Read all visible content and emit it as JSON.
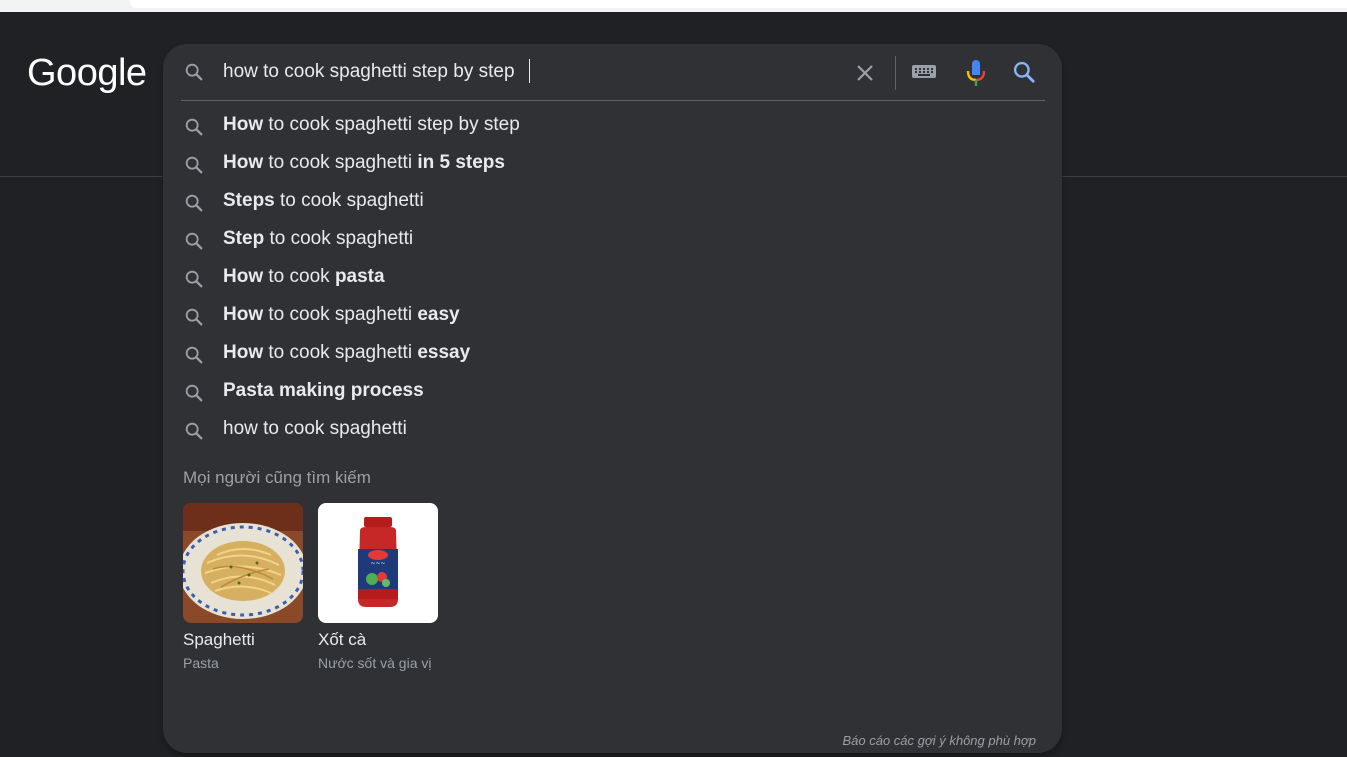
{
  "logo": {
    "text": "Google"
  },
  "search": {
    "query": "how to cook spaghetti step by step",
    "icons": {
      "lead": "search-icon",
      "clear": "close-icon",
      "keyboard": "keyboard-icon",
      "voice": "microphone-icon",
      "submit": "search-icon"
    }
  },
  "suggestions": [
    {
      "parts": [
        {
          "t": "How",
          "b": true
        },
        {
          "t": " to cook spaghetti step by step",
          "b": false
        }
      ]
    },
    {
      "parts": [
        {
          "t": "How",
          "b": true
        },
        {
          "t": " to cook spaghetti ",
          "b": false
        },
        {
          "t": "in 5 steps",
          "b": true
        }
      ]
    },
    {
      "parts": [
        {
          "t": "Steps",
          "b": true
        },
        {
          "t": " to cook spaghetti",
          "b": false
        }
      ]
    },
    {
      "parts": [
        {
          "t": "Step",
          "b": true
        },
        {
          "t": " to cook spaghetti",
          "b": false
        }
      ]
    },
    {
      "parts": [
        {
          "t": "How",
          "b": true
        },
        {
          "t": " to cook ",
          "b": false
        },
        {
          "t": "pasta",
          "b": true
        }
      ]
    },
    {
      "parts": [
        {
          "t": "How",
          "b": true
        },
        {
          "t": " to cook spaghetti ",
          "b": false
        },
        {
          "t": "easy",
          "b": true
        }
      ]
    },
    {
      "parts": [
        {
          "t": "How",
          "b": true
        },
        {
          "t": " to cook spaghetti ",
          "b": false
        },
        {
          "t": "essay",
          "b": true
        }
      ]
    },
    {
      "parts": [
        {
          "t": "Pasta making process",
          "b": true
        }
      ]
    },
    {
      "parts": [
        {
          "t": "how to cook spaghetti",
          "b": false
        }
      ]
    }
  ],
  "people_also_search": {
    "title": "Mọi người cũng tìm kiếm",
    "cards": [
      {
        "title": "Spaghetti",
        "subtitle": "Pasta"
      },
      {
        "title": "Xốt cà",
        "subtitle": "Nước sốt và gia vị"
      }
    ]
  },
  "report_link": "Báo cáo các gợi ý không phù hợp",
  "colors": {
    "background": "#202124",
    "panel": "#303134",
    "text": "#e8eaed",
    "muted": "#9aa0a6",
    "accent_blue": "#8ab4f8"
  }
}
